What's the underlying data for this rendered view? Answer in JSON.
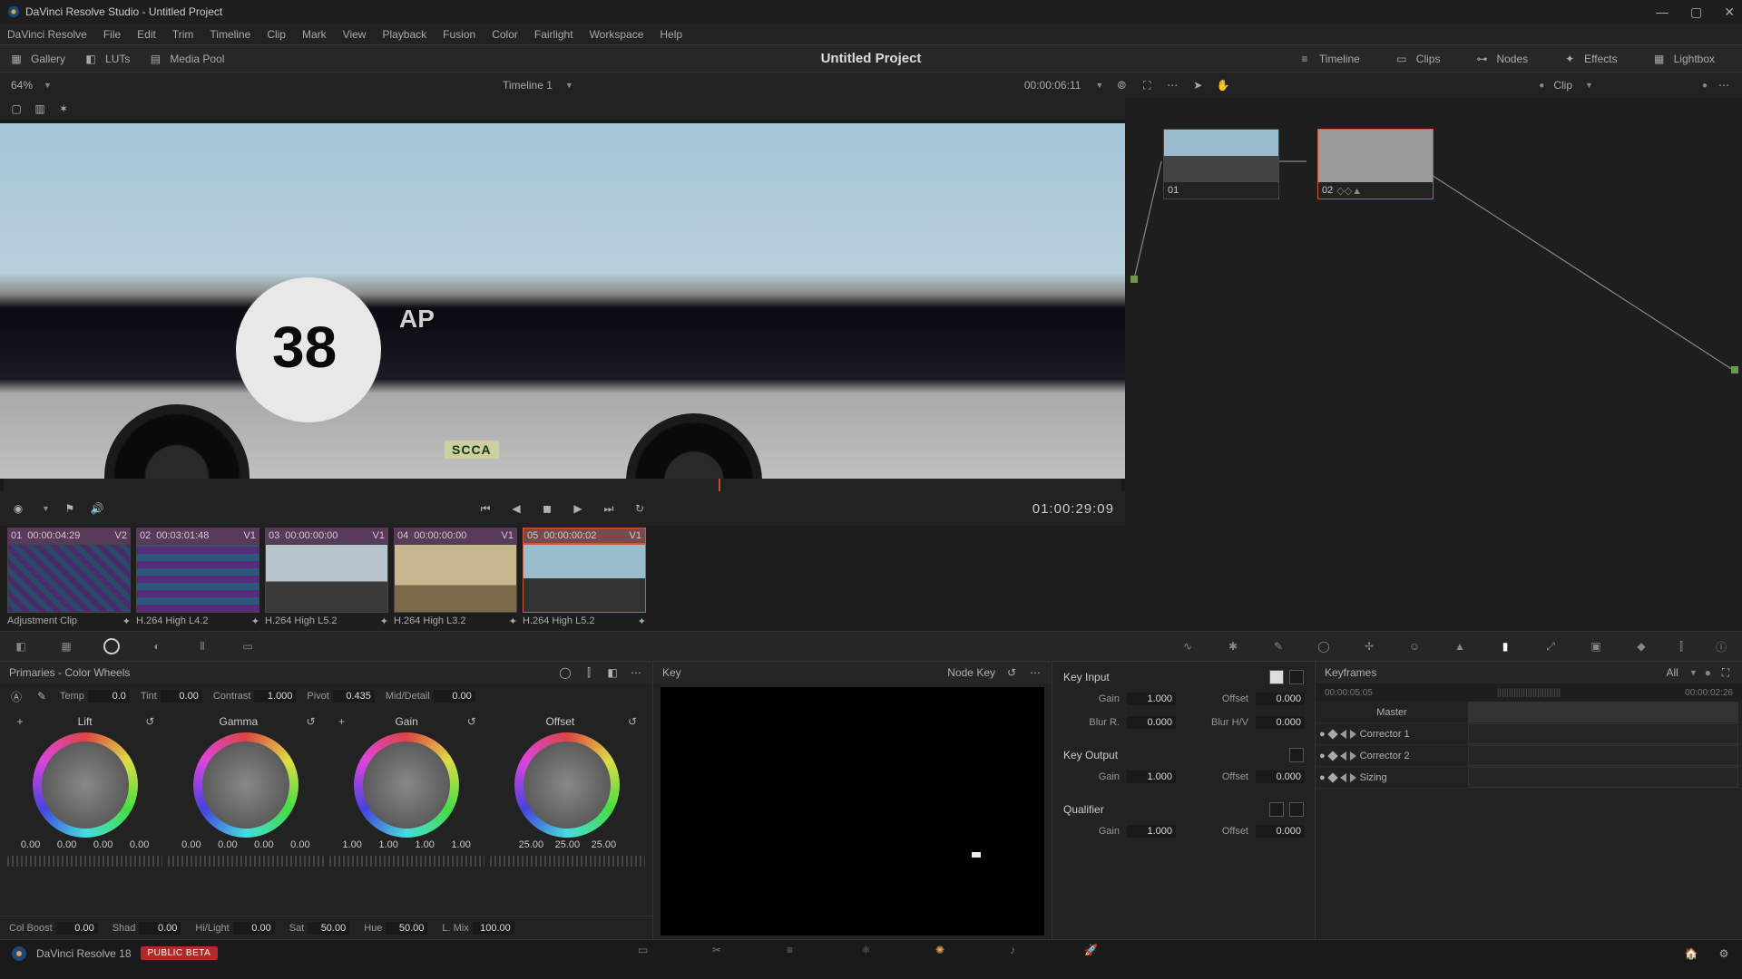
{
  "window": {
    "title": "DaVinci Resolve Studio - Untitled Project"
  },
  "menu": [
    "DaVinci Resolve",
    "File",
    "Edit",
    "Trim",
    "Timeline",
    "Clip",
    "Mark",
    "View",
    "Playback",
    "Fusion",
    "Color",
    "Fairlight",
    "Workspace",
    "Help"
  ],
  "toolbar": {
    "gallery": "Gallery",
    "luts": "LUTs",
    "mediapool": "Media Pool",
    "project": "Untitled Project",
    "timeline": "Timeline",
    "clips": "Clips",
    "nodes": "Nodes",
    "effects": "Effects",
    "lightbox": "Lightbox"
  },
  "viewer": {
    "zoom": "64%",
    "timeline_name": "Timeline 1",
    "timecode": "00:00:06:11",
    "clip_label": "Clip",
    "transport_tc": "01:00:29:09",
    "car_num": "38",
    "ap": "AP",
    "scca": "SCCA"
  },
  "nodes": {
    "n1": "01",
    "n2": "02"
  },
  "clips": [
    {
      "idx": "01",
      "tc": "00:00:04:29",
      "track": "V2",
      "name": "Adjustment Clip"
    },
    {
      "idx": "02",
      "tc": "00:03:01:48",
      "track": "V1",
      "name": "H.264 High L4.2"
    },
    {
      "idx": "03",
      "tc": "00:00:00:00",
      "track": "V1",
      "name": "H.264 High L5.2"
    },
    {
      "idx": "04",
      "tc": "00:00:00:00",
      "track": "V1",
      "name": "H.264 High L3.2"
    },
    {
      "idx": "05",
      "tc": "00:00:00:02",
      "track": "V1",
      "name": "H.264 High L5.2"
    }
  ],
  "primaries": {
    "title": "Primaries - Color Wheels",
    "temp_l": "Temp",
    "temp": "0.0",
    "tint_l": "Tint",
    "tint": "0.00",
    "contrast_l": "Contrast",
    "contrast": "1.000",
    "pivot_l": "Pivot",
    "pivot": "0.435",
    "md_l": "Mid/Detail",
    "md": "0.00",
    "wheels": [
      {
        "name": "Lift",
        "vals": [
          "0.00",
          "0.00",
          "0.00",
          "0.00"
        ]
      },
      {
        "name": "Gamma",
        "vals": [
          "0.00",
          "0.00",
          "0.00",
          "0.00"
        ]
      },
      {
        "name": "Gain",
        "vals": [
          "1.00",
          "1.00",
          "1.00",
          "1.00"
        ]
      },
      {
        "name": "Offset",
        "vals": [
          "25.00",
          "25.00",
          "25.00"
        ]
      }
    ],
    "colboost_l": "Col Boost",
    "colboost": "0.00",
    "shad_l": "Shad",
    "shad": "0.00",
    "hilight_l": "Hi/Light",
    "hilight": "0.00",
    "sat_l": "Sat",
    "sat": "50.00",
    "hue_l": "Hue",
    "hue": "50.00",
    "lmix_l": "L. Mix",
    "lmix": "100.00"
  },
  "key": {
    "title": "Key",
    "nodekey": "Node Key",
    "input": "Key Input",
    "output": "Key Output",
    "qualifier": "Qualifier",
    "gain_l": "Gain",
    "offset_l": "Offset",
    "blurr_l": "Blur R.",
    "blurhv_l": "Blur H/V",
    "in_gain": "1.000",
    "in_offset": "0.000",
    "in_blurr": "0.000",
    "in_blurhv": "0.000",
    "out_gain": "1.000",
    "out_offset": "0.000",
    "q_gain": "1.000",
    "q_offset": "0.000"
  },
  "kf": {
    "title": "Keyframes",
    "all": "All",
    "tc1": "00:00:05:05",
    "tc2": "00:00:02:26",
    "master": "Master",
    "c1": "Corrector 1",
    "c2": "Corrector 2",
    "sizing": "Sizing"
  },
  "footer": {
    "app": "DaVinci Resolve 18",
    "beta": "PUBLIC BETA"
  }
}
